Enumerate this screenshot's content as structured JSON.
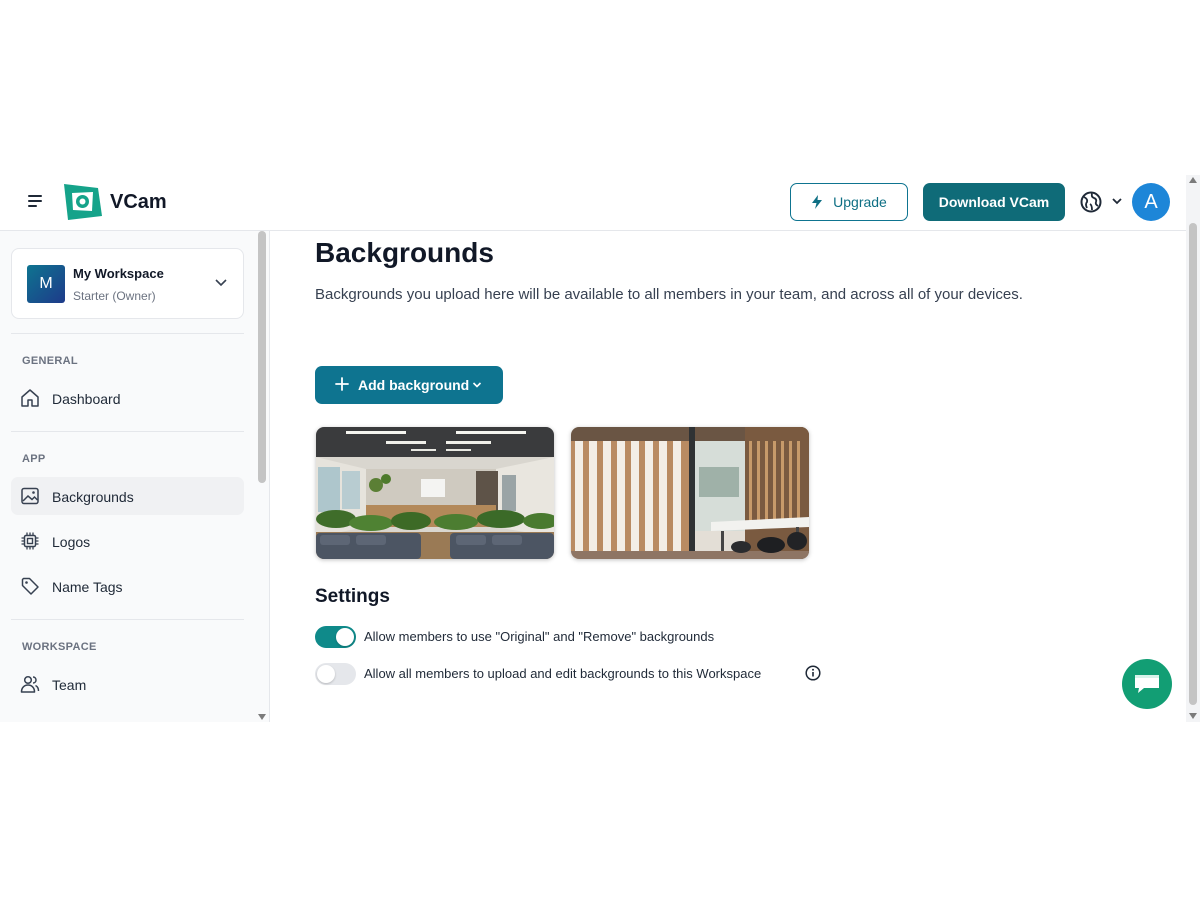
{
  "app": {
    "name": "VCam",
    "brand_color": "#0e7490",
    "accent_color": "#0f6b78"
  },
  "header": {
    "menu_icon": "hamburger-icon",
    "upgrade_label": "Upgrade",
    "download_label": "Download VCam",
    "avatar_initial": "A",
    "avatar_color": "#1d86d8"
  },
  "sidebar": {
    "workspace": {
      "initial": "M",
      "name": "My Workspace",
      "plan": "Starter (Owner)"
    },
    "sections": [
      {
        "label": "GENERAL",
        "items": [
          {
            "label": "Dashboard",
            "icon": "home-icon"
          }
        ]
      },
      {
        "label": "APP",
        "items": [
          {
            "label": "Backgrounds",
            "icon": "image-icon",
            "active": true
          },
          {
            "label": "Logos",
            "icon": "chip-icon"
          },
          {
            "label": "Name Tags",
            "icon": "tag-icon"
          }
        ]
      },
      {
        "label": "WORKSPACE",
        "items": [
          {
            "label": "Team",
            "icon": "users-icon"
          }
        ]
      }
    ]
  },
  "main": {
    "title": "Backgrounds",
    "description": "Backgrounds you upload here will be available to all members in your team, and across all of your devices.",
    "add_button_label": "Add background",
    "backgrounds": [
      {
        "kind": "open-office-photo"
      },
      {
        "kind": "wooden-slats-meeting-room-photo"
      }
    ],
    "settings": {
      "title": "Settings",
      "options": [
        {
          "label": "Allow members to use \"Original\" and \"Remove\" backgrounds",
          "enabled": true
        },
        {
          "label": "Allow all members to upload and edit backgrounds to this Workspace",
          "enabled": false
        }
      ]
    }
  },
  "chat": {
    "icon": "chat-icon",
    "color": "#129e74"
  }
}
